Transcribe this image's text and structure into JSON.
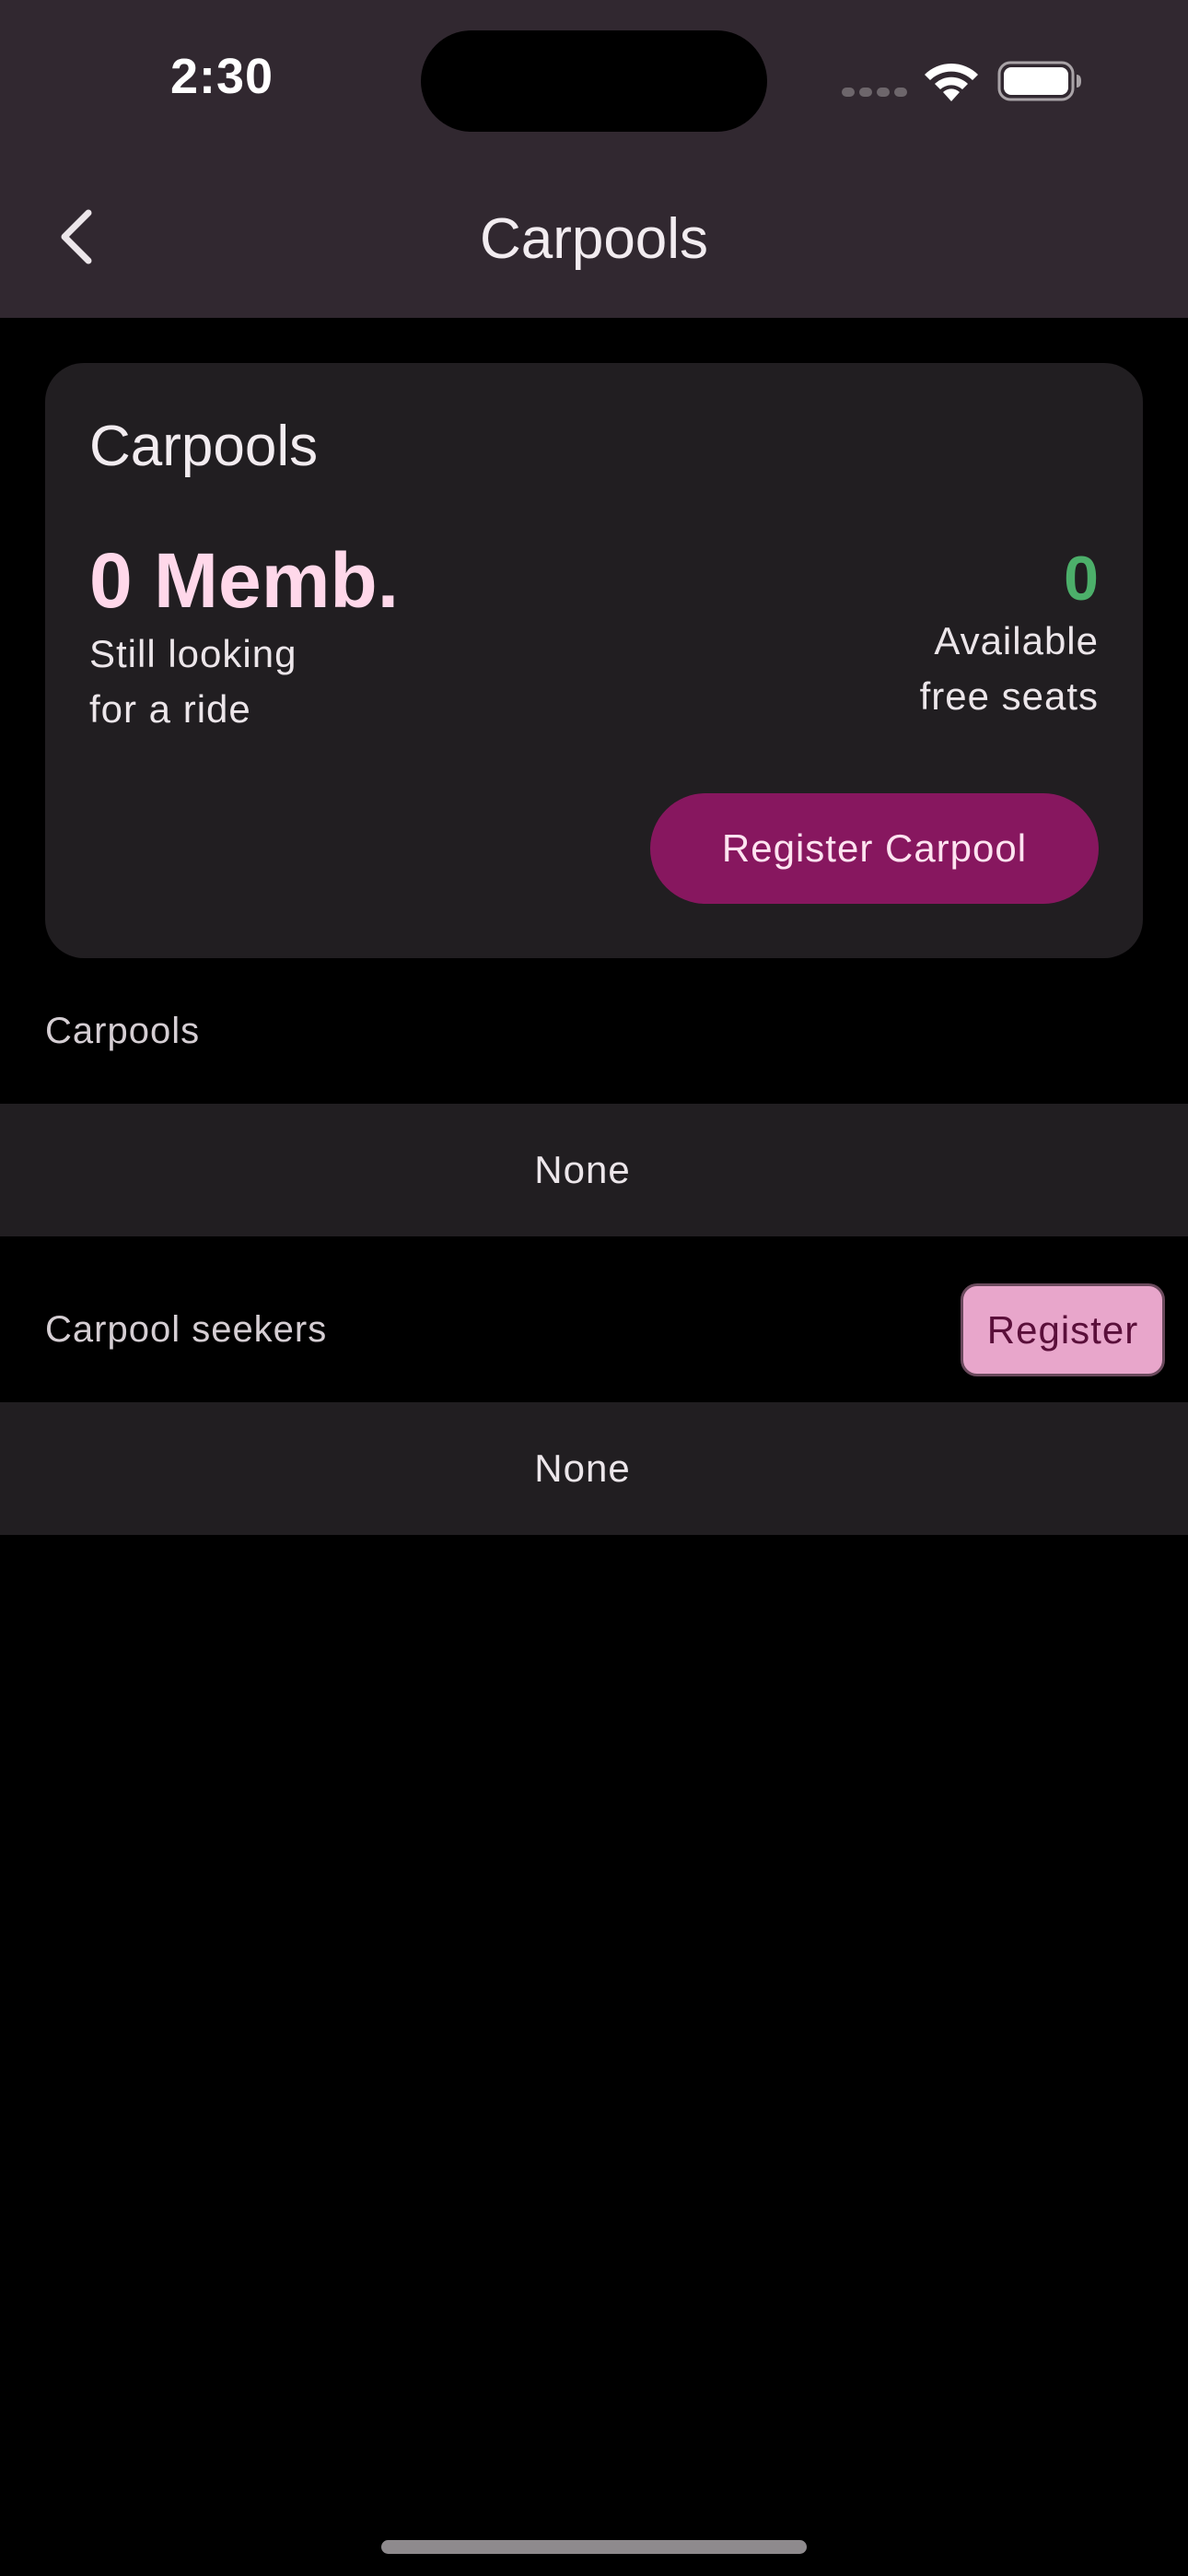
{
  "status_bar": {
    "time": "2:30",
    "icons": [
      "cellular-signal-icon",
      "wifi-icon",
      "battery-icon"
    ]
  },
  "nav": {
    "title": "Carpools",
    "back_icon": "chevron-left-icon"
  },
  "summary": {
    "title": "Carpools",
    "members_count": "0 Memb.",
    "members_caption_line1": "Still looking",
    "members_caption_line2": "for a ride",
    "seats_count": "0",
    "seats_caption_line1": "Available",
    "seats_caption_line2": "free seats",
    "register_carpool_label": "Register Carpool"
  },
  "carpools_section": {
    "header": "Carpools",
    "empty_text": "None"
  },
  "seekers_section": {
    "header": "Carpool seekers",
    "register_label": "Register",
    "empty_text": "None"
  },
  "colors": {
    "bar_background": "#312830",
    "card_background": "#211e21",
    "members_accent": "#ffd8ea",
    "seats_accent": "#4caf6a",
    "primary_button": "#87175f",
    "secondary_button": "#e8a6cb"
  }
}
